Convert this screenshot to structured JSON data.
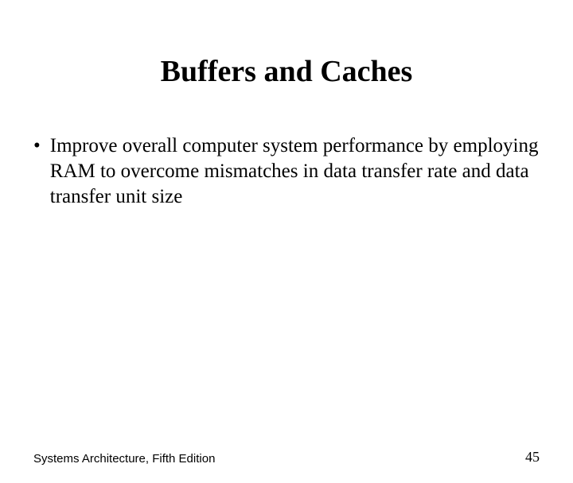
{
  "slide": {
    "title": "Buffers and Caches",
    "bullet": {
      "marker": "•",
      "text": "Improve overall computer system performance by employing RAM to overcome mismatches in data transfer rate and data transfer unit size"
    },
    "footer": {
      "source": "Systems Architecture, Fifth Edition",
      "page": "45"
    }
  }
}
